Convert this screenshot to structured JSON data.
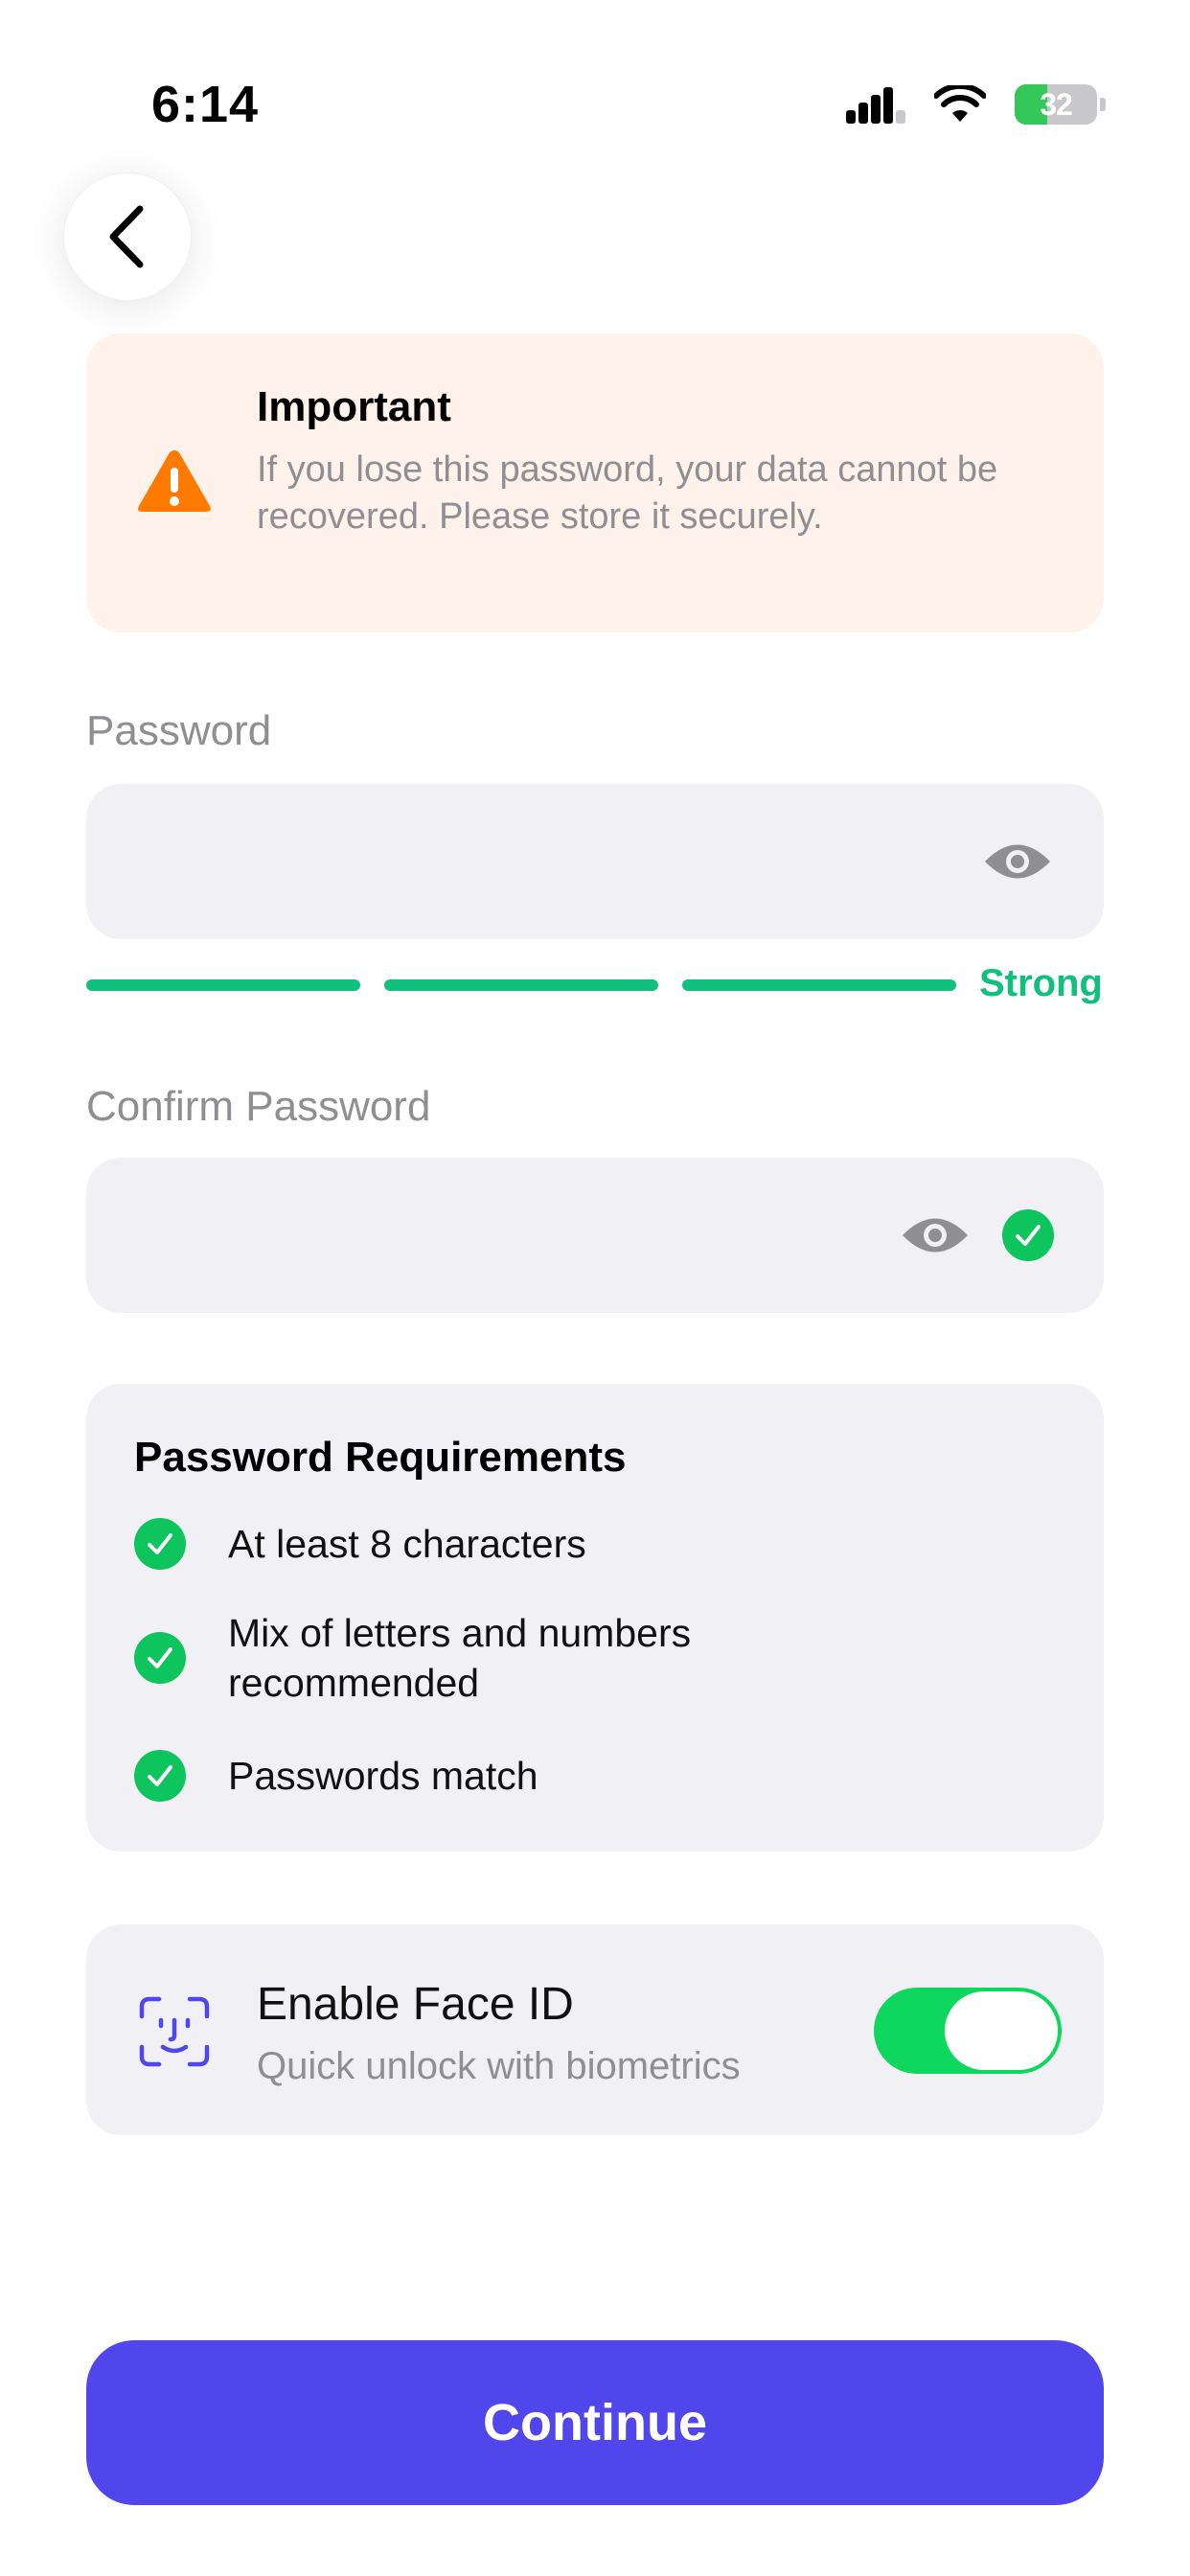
{
  "status_bar": {
    "time": "6:14",
    "battery_level": "32"
  },
  "warning": {
    "title": "Important",
    "text": "If you lose this password, your data cannot be recovered. Please store it securely.",
    "icon": "warning-triangle-icon"
  },
  "password_field": {
    "label": "Password",
    "value": "",
    "strength": "Strong",
    "strength_segments_filled": 3
  },
  "confirm_field": {
    "label": "Confirm Password",
    "value": ""
  },
  "requirements": {
    "title": "Password Requirements",
    "items": [
      {
        "text": "At least 8 characters"
      },
      {
        "text": "Mix of letters and numbers recommended"
      },
      {
        "text": "Passwords match"
      }
    ]
  },
  "face_id": {
    "title": "Enable Face ID",
    "subtitle": "Quick unlock with biometrics",
    "enabled": true
  },
  "continue_label": "Continue",
  "colors": {
    "accent": "#5046EC",
    "success": "#11C07D",
    "warning": "#FF7A00",
    "toggle_on": "#0ED75E"
  }
}
